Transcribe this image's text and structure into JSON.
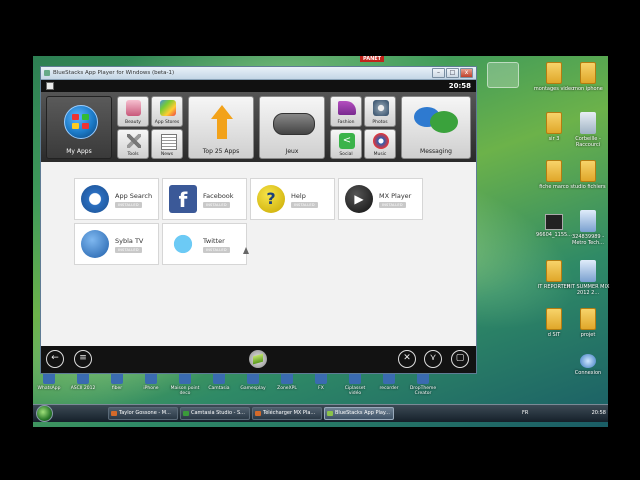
{
  "bluestacks": {
    "title": "BlueStacks App Player for Windows (beta-1)",
    "clock": "20:58",
    "categories": {
      "my_apps": "My Apps",
      "beauty": "Beauty",
      "app_stores": "App Stores",
      "tools": "Tools",
      "news": "News",
      "top25": "Top 25 Apps",
      "games": "Jeux",
      "fashion": "Fashion",
      "photos": "Photos",
      "social": "Social",
      "music": "Music",
      "messaging": "Messaging"
    },
    "apps": [
      {
        "name": "App Search",
        "badge": "INSTALLED"
      },
      {
        "name": "Facebook",
        "badge": "INSTALLED"
      },
      {
        "name": "Help",
        "badge": "INSTALLED"
      },
      {
        "name": "MX Player",
        "badge": "INSTALLED"
      },
      {
        "name": "Sybla TV",
        "badge": "INSTALLED"
      },
      {
        "name": "Twitter",
        "badge": "INSTALLED"
      }
    ]
  },
  "desktop": {
    "banner": "PANET",
    "icons": [
      {
        "label": "montages video"
      },
      {
        "label": "mon iphone"
      },
      {
        "label": "sir 3"
      },
      {
        "label": "Corbeille - Raccourci"
      },
      {
        "label": "fiche marco"
      },
      {
        "label": "studio fichiers"
      },
      {
        "label": "96604_1155..."
      },
      {
        "label": "324839989 - Metro Tech..."
      },
      {
        "label": "IT REPORTER"
      },
      {
        "label": "HIT SUMMER MIX 2012 2..."
      },
      {
        "label": "d SIT"
      },
      {
        "label": "projet"
      },
      {
        "label": "Connexion"
      }
    ],
    "bottom_icons": [
      "WhatsApp",
      "ASCII 2012",
      "fiber",
      "iPhone",
      "Maison point deco",
      "Camtasia",
      "Gamesplay",
      "ZoneXPL",
      "FX",
      "Ciplasset vidéo",
      "recorder",
      "DropTheme Creator"
    ]
  },
  "taskbar": {
    "items": [
      "Taylor Gossone - M...",
      "Camtasia Studio - S...",
      "Télécharger MX Pla...",
      "BlueStacks App Play..."
    ],
    "lang": "FR",
    "time": "20:58"
  },
  "colors": {
    "window_dark": "#2a2a2a",
    "my_apps_tile": "#1b7ac7",
    "desktop_green": "#3f9a5a",
    "taskbar": "#15202a"
  }
}
